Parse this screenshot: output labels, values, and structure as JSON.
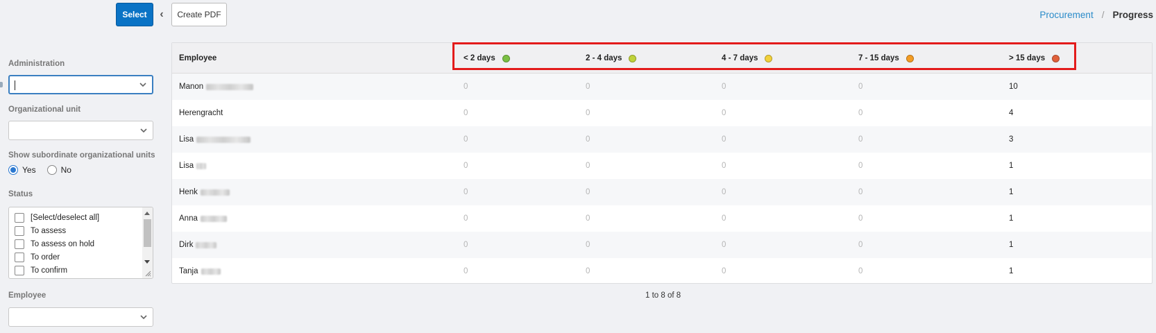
{
  "toolbar": {
    "select_label": "Select",
    "create_pdf_label": "Create PDF"
  },
  "breadcrumb": {
    "parent": "Procurement",
    "separator": "/",
    "current": "Progress"
  },
  "filters": {
    "administration": {
      "label": "Administration",
      "value": ""
    },
    "org_unit": {
      "label": "Organizational unit",
      "value": ""
    },
    "subordinate": {
      "label": "Show subordinate organizational units",
      "options": [
        "Yes",
        "No"
      ],
      "selected": "Yes"
    },
    "status": {
      "label": "Status",
      "items": [
        "[Select/deselect all]",
        "To assess",
        "To assess on hold",
        "To order",
        "To confirm"
      ]
    },
    "employee": {
      "label": "Employee",
      "value": ""
    }
  },
  "table": {
    "columns": [
      {
        "label": "Employee"
      },
      {
        "label": "< 2 days",
        "color": "#7bc043"
      },
      {
        "label": "2 - 4 days",
        "color": "#bfd23a"
      },
      {
        "label": "4 - 7 days",
        "color": "#f2d13b"
      },
      {
        "label": "7 - 15 days",
        "color": "#f39c24"
      },
      {
        "label": "> 15 days",
        "color": "#e0603a"
      }
    ],
    "rows": [
      {
        "employee": "Manon",
        "values": [
          "0",
          "0",
          "0",
          "0",
          "10"
        ]
      },
      {
        "employee": "Herengracht",
        "values": [
          "0",
          "0",
          "0",
          "0",
          "4"
        ]
      },
      {
        "employee": "Lisa",
        "values": [
          "0",
          "0",
          "0",
          "0",
          "3"
        ]
      },
      {
        "employee": "Lisa",
        "values": [
          "0",
          "0",
          "0",
          "0",
          "1"
        ]
      },
      {
        "employee": "Henk",
        "values": [
          "0",
          "0",
          "0",
          "0",
          "1"
        ]
      },
      {
        "employee": "Anna",
        "values": [
          "0",
          "0",
          "0",
          "0",
          "1"
        ]
      },
      {
        "employee": "Dirk",
        "values": [
          "0",
          "0",
          "0",
          "0",
          "1"
        ]
      },
      {
        "employee": "Tanja",
        "values": [
          "0",
          "0",
          "0",
          "0",
          "1"
        ]
      }
    ],
    "pagination": "1 to 8 of 8"
  },
  "colors": {
    "primary": "#0a73c5",
    "link": "#2a8bc9",
    "highlight": "#e31b1b"
  }
}
